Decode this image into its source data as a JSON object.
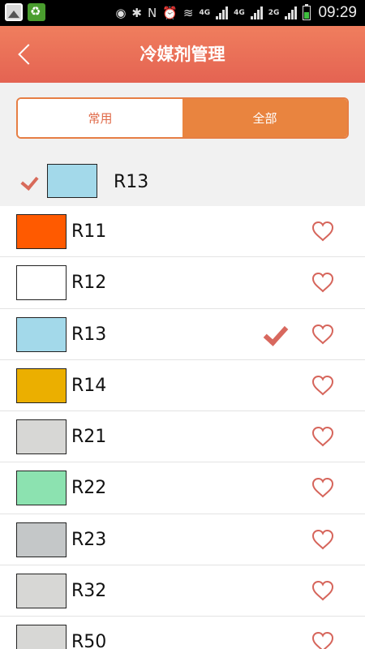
{
  "status_bar": {
    "time": "09:29",
    "network_labels": [
      "4G",
      "4G",
      "2G"
    ]
  },
  "header": {
    "title": "冷媒剂管理",
    "back_icon": "chevron-left-icon"
  },
  "tabs": [
    {
      "label": "常用",
      "active": false
    },
    {
      "label": "全部",
      "active": true
    }
  ],
  "selected": {
    "label": "R13",
    "color": "#a3d9ea"
  },
  "refrigerants": [
    {
      "label": "R11",
      "color": "#ff5a00",
      "checked": false
    },
    {
      "label": "R12",
      "color": "#ffffff",
      "checked": false
    },
    {
      "label": "R13",
      "color": "#a3d9ea",
      "checked": true
    },
    {
      "label": "R14",
      "color": "#ebaf00",
      "checked": false
    },
    {
      "label": "R21",
      "color": "#d7d7d5",
      "checked": false
    },
    {
      "label": "R22",
      "color": "#8ce2b0",
      "checked": false
    },
    {
      "label": "R23",
      "color": "#c4c7c8",
      "checked": false
    },
    {
      "label": "R32",
      "color": "#d7d7d5",
      "checked": false
    },
    {
      "label": "R50",
      "color": "#d7d7d5",
      "checked": false
    }
  ],
  "colors": {
    "accent": "#e9843f",
    "header": "#e86a55",
    "heart": "#d6655b"
  }
}
